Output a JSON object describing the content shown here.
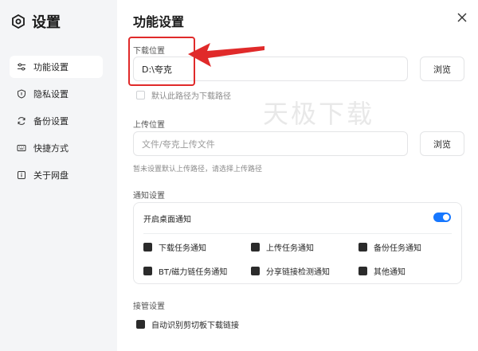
{
  "app": {
    "title": "设置"
  },
  "sidebar": {
    "items": [
      {
        "label": "功能设置",
        "icon": "sliders-icon",
        "active": true
      },
      {
        "label": "隐私设置",
        "icon": "shield-icon",
        "active": false
      },
      {
        "label": "备份设置",
        "icon": "sync-icon",
        "active": false
      },
      {
        "label": "快捷方式",
        "icon": "keyboard-icon",
        "active": false
      },
      {
        "label": "关于网盘",
        "icon": "info-icon",
        "active": false
      }
    ]
  },
  "page": {
    "title": "功能设置"
  },
  "download": {
    "label": "下载位置",
    "path": "D:\\夸克",
    "browse_label": "浏览",
    "default_checkbox_label": "默认此路径为下载路径",
    "default_checked": false
  },
  "upload": {
    "label": "上传位置",
    "placeholder": "文件/夸克上传文件",
    "browse_label": "浏览",
    "helper": "暂未设置默认上传路径，请选择上传路径"
  },
  "notifications": {
    "label": "通知设置",
    "desktop_label": "开启桌面通知",
    "desktop_enabled": true,
    "options": [
      {
        "label": "下载任务通知",
        "checked": true
      },
      {
        "label": "上传任务通知",
        "checked": true
      },
      {
        "label": "备份任务通知",
        "checked": true
      },
      {
        "label": "BT/磁力链任务通知",
        "checked": true
      },
      {
        "label": "分享链接检测通知",
        "checked": true
      },
      {
        "label": "其他通知",
        "checked": true
      }
    ]
  },
  "takeover": {
    "label": "接管设置",
    "clipboard_label": "自动识别剪切板下载链接",
    "clipboard_checked": true
  },
  "watermark": "天极下载",
  "colors": {
    "accent": "#1677ff",
    "annotation": "#e02a2a",
    "sidebar_bg": "#f4f5f7"
  }
}
